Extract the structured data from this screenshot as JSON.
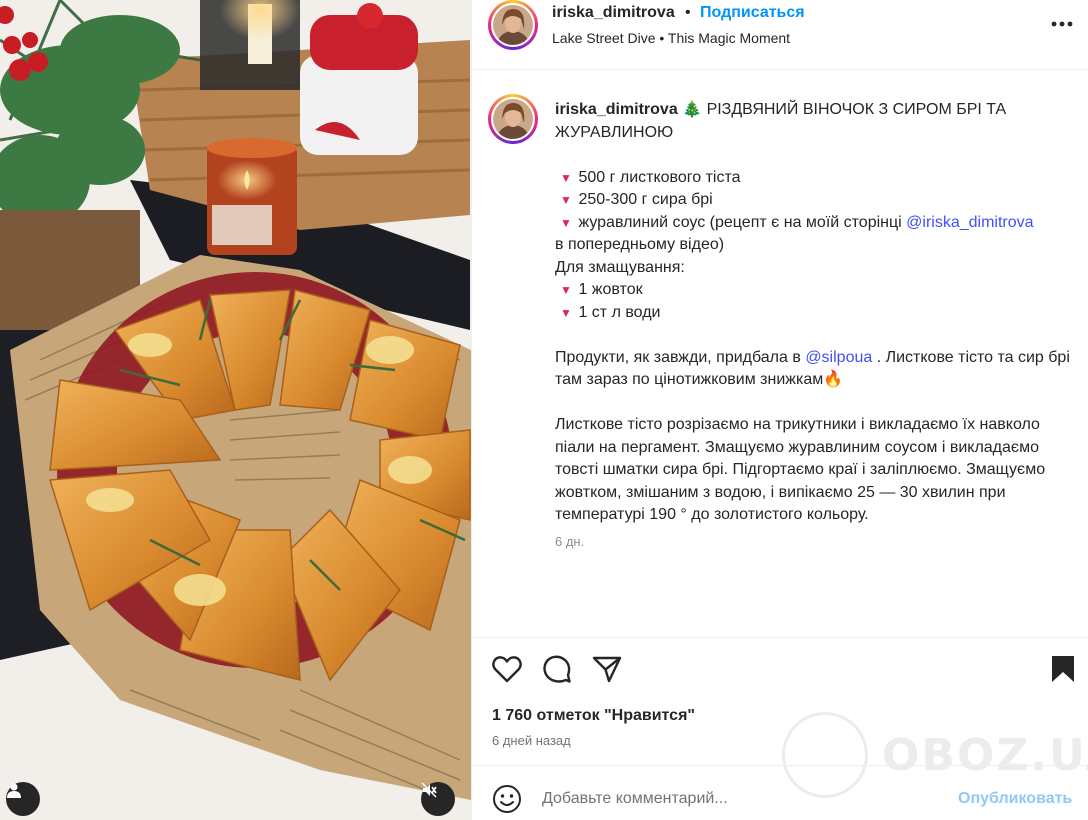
{
  "post": {
    "username": "iriska_dimitrova",
    "dot": "•",
    "follow_label": "Подписаться",
    "music": "Lake Street Dive • This Magic Moment"
  },
  "caption": {
    "username": "iriska_dimitrova",
    "title_emoji": "🎄",
    "title": "РІЗДВЯНИЙ ВІНОЧОК З СИРОМ БРІ ТА ЖУРАВЛИНОЮ",
    "bullet": "▼",
    "ingredients": [
      "500 г листкового тіста",
      "250-300 г сира брі"
    ],
    "sauce_text": "журавлиний соус (рецепт є на моїй сторінці",
    "sauce_mention": "@iriska_dimitrova",
    "sauce_tail": "в попередньому відео)",
    "greasing_label": "Для змащування:",
    "greasing": [
      "1 жовток",
      "1 ст л води"
    ],
    "products_text": "Продукти, як завжди, придбала в",
    "products_mention": "@silpoua",
    "products_tail": ". Листкове тісто та сир брі там зараз по цінотижковим знижкам",
    "fire_emoji": "🔥",
    "steps": "Листкове тісто розрізаємо на трикутники і викладаємо їх навколо піали на пергамент. Змащуємо журавлиним соусом і викладаємо товсті шматки сира брі. Підгортаємо краї і заліплюємо. Змащуємо жовтком, змішаним з водою, і випікаємо 25 — 30 хвилин при температурі 190 ° до золотистого кольору.",
    "time": "6 дн."
  },
  "stats": {
    "likes": "1 760 отметок \"Нравится\"",
    "posted": "6 дней назад"
  },
  "comment": {
    "placeholder": "Добавьте комментарий...",
    "publish_label": "Опубликовать"
  },
  "watermark": {
    "text": "OBOZ.UA"
  },
  "icons": {
    "like": "heart-icon",
    "comment": "comment-icon",
    "share": "share-icon",
    "save": "bookmark-icon",
    "more": "more-icon",
    "emoji": "emoji-icon",
    "user_tag": "user-icon",
    "mute": "mute-icon"
  },
  "colors": {
    "accent": "#0095f6",
    "mention": "#4150f7",
    "publish_disabled": "#8fc9f7",
    "bullet": "#e0245e"
  }
}
